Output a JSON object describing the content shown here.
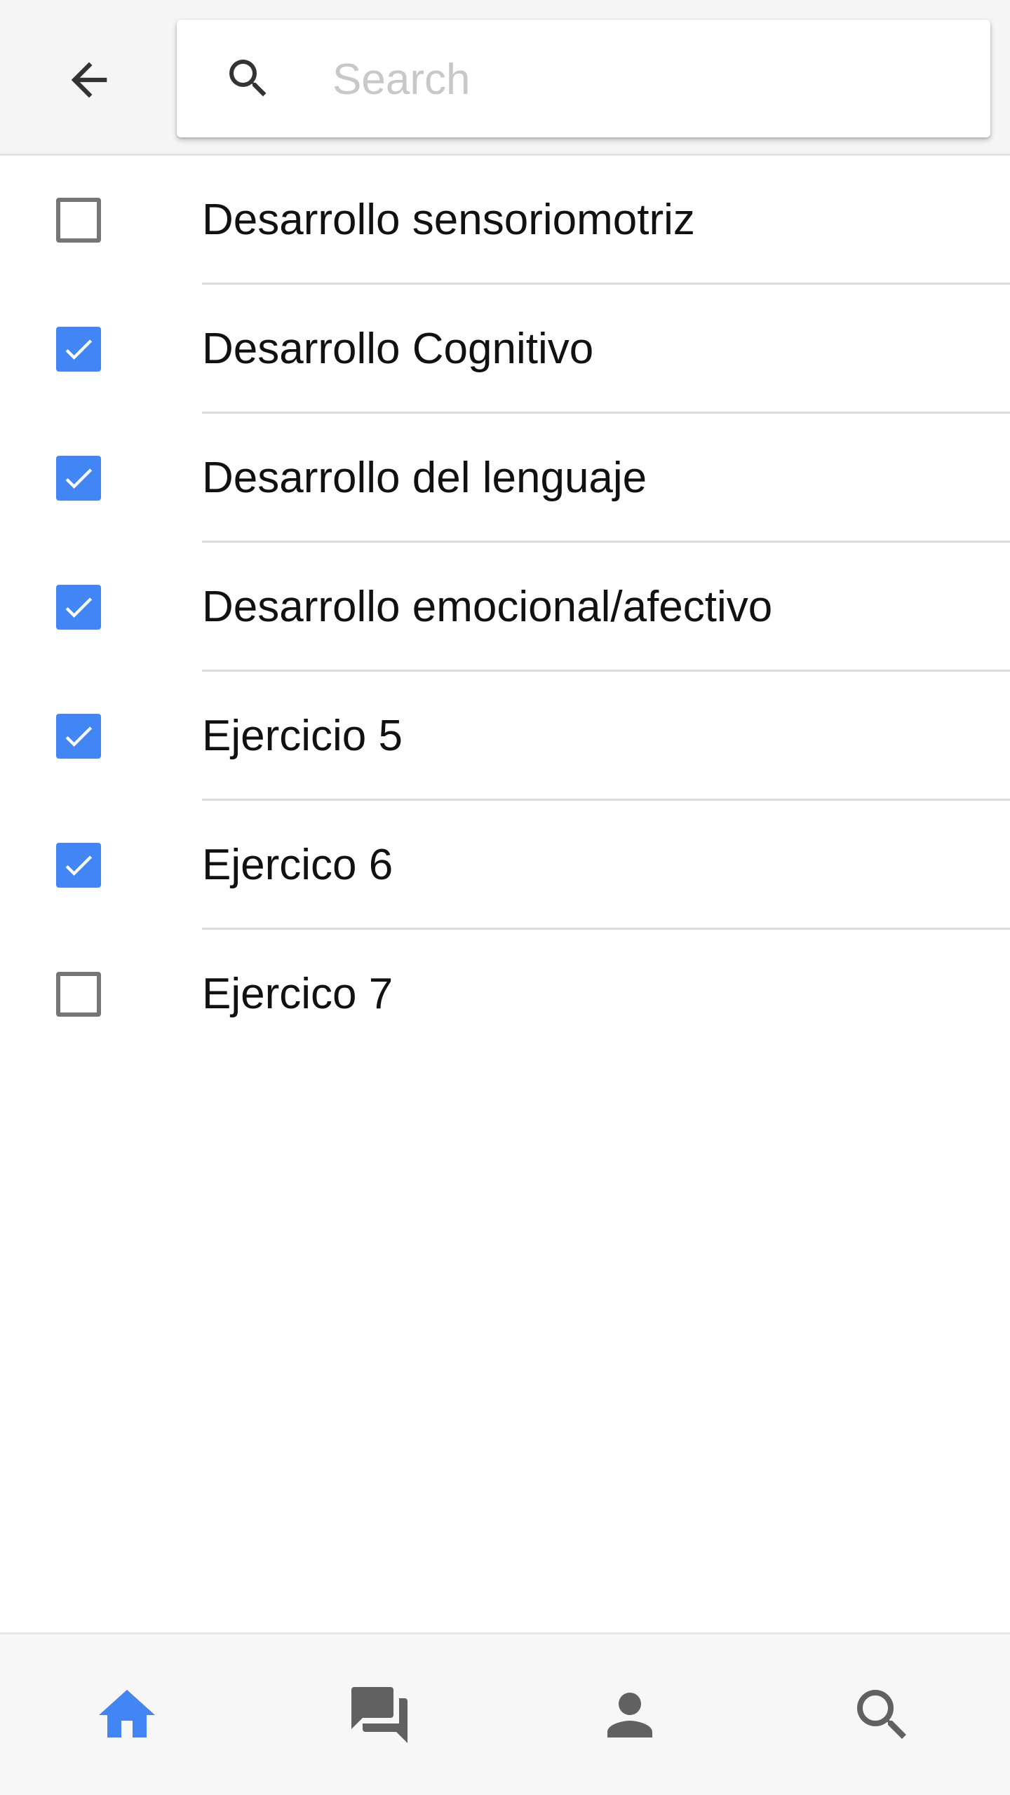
{
  "search": {
    "placeholder": "Search",
    "value": ""
  },
  "icons": {
    "back": "arrow-back-icon",
    "search": "search-icon"
  },
  "items": [
    {
      "label": "Desarrollo sensoriomotriz",
      "checked": false
    },
    {
      "label": "Desarrollo Cognitivo",
      "checked": true
    },
    {
      "label": "Desarrollo del lenguaje",
      "checked": true
    },
    {
      "label": "Desarrollo emocional/afectivo",
      "checked": true
    },
    {
      "label": "Ejercicio 5",
      "checked": true
    },
    {
      "label": "Ejercico 6",
      "checked": true
    },
    {
      "label": "Ejercico 7",
      "checked": false
    }
  ],
  "bottom_nav": {
    "items": [
      {
        "icon": "home-icon",
        "active": true
      },
      {
        "icon": "chat-icon",
        "active": false
      },
      {
        "icon": "person-icon",
        "active": false
      },
      {
        "icon": "search-icon",
        "active": false
      }
    ]
  },
  "colors": {
    "accent": "#4285f4",
    "inactive_icon": "#616161",
    "checkbox_border": "#757575",
    "divider": "#dcdcdc"
  }
}
